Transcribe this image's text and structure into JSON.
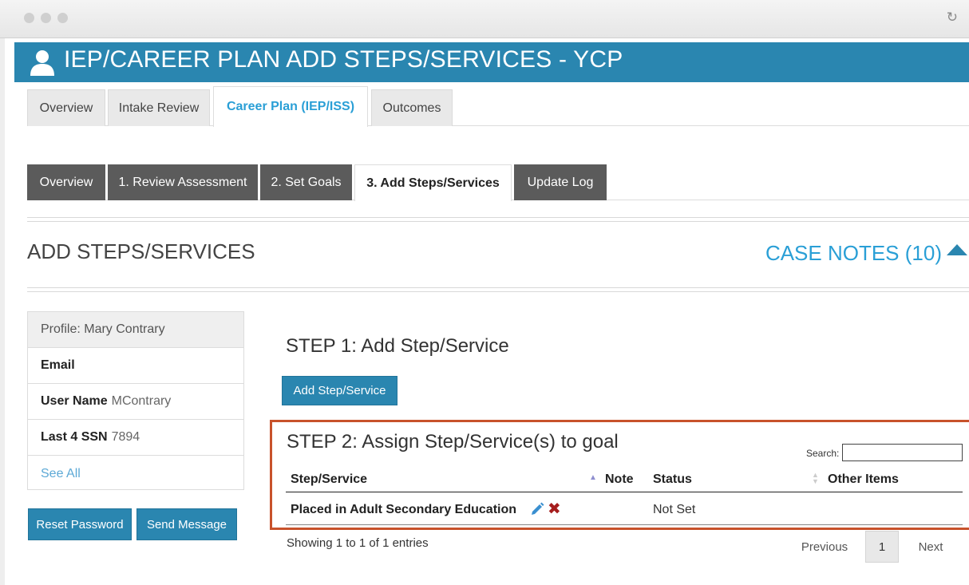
{
  "window": {
    "reload_icon": "reload-icon"
  },
  "header": {
    "title": "IEP/CAREER PLAN ADD STEPS/SERVICES - YCP",
    "icon": "user-icon"
  },
  "top_tabs": [
    {
      "label": "Overview"
    },
    {
      "label": "Intake Review"
    },
    {
      "label": "Career Plan (IEP/ISS)",
      "active": true
    },
    {
      "label": "Outcomes"
    }
  ],
  "sub_tabs": [
    {
      "label": "Overview"
    },
    {
      "label": "1. Review Assessment"
    },
    {
      "label": "2. Set Goals"
    },
    {
      "label": "3. Add Steps/Services",
      "active": true
    },
    {
      "label": "Update Log"
    }
  ],
  "section": {
    "title": "ADD STEPS/SERVICES",
    "case_notes": "CASE NOTES (10)"
  },
  "profile": {
    "header": "Profile: Mary Contrary",
    "email_label": "Email",
    "email_value": "",
    "username_label": "User Name",
    "username_value": "MContrary",
    "ssn_label": "Last 4 SSN",
    "ssn_value": "7894",
    "see_all": "See All"
  },
  "actions": {
    "reset_password": "Reset Password",
    "send_message": "Send Message"
  },
  "step1": {
    "title": "STEP 1: Add Step/Service",
    "button": "Add Step/Service"
  },
  "step2": {
    "title": "STEP 2: Assign Step/Service(s) to goal",
    "search_label": "Search:",
    "search_value": "",
    "columns": [
      "Step/Service",
      "Note",
      "Status",
      "Other Items"
    ],
    "rows": [
      {
        "step_service": "Placed in Adult Secondary Education",
        "note": "",
        "status": "Not Set",
        "other_items": ""
      }
    ],
    "info": "Showing 1 to 1 of 1 entries",
    "pagination": {
      "previous": "Previous",
      "current": "1",
      "next": "Next"
    }
  },
  "colors": {
    "primary": "#2a86b0",
    "link": "#2a9fd6",
    "highlight_box": "#c8522b",
    "dark_tab": "#5b5b5b",
    "delete": "#a51d1d"
  }
}
